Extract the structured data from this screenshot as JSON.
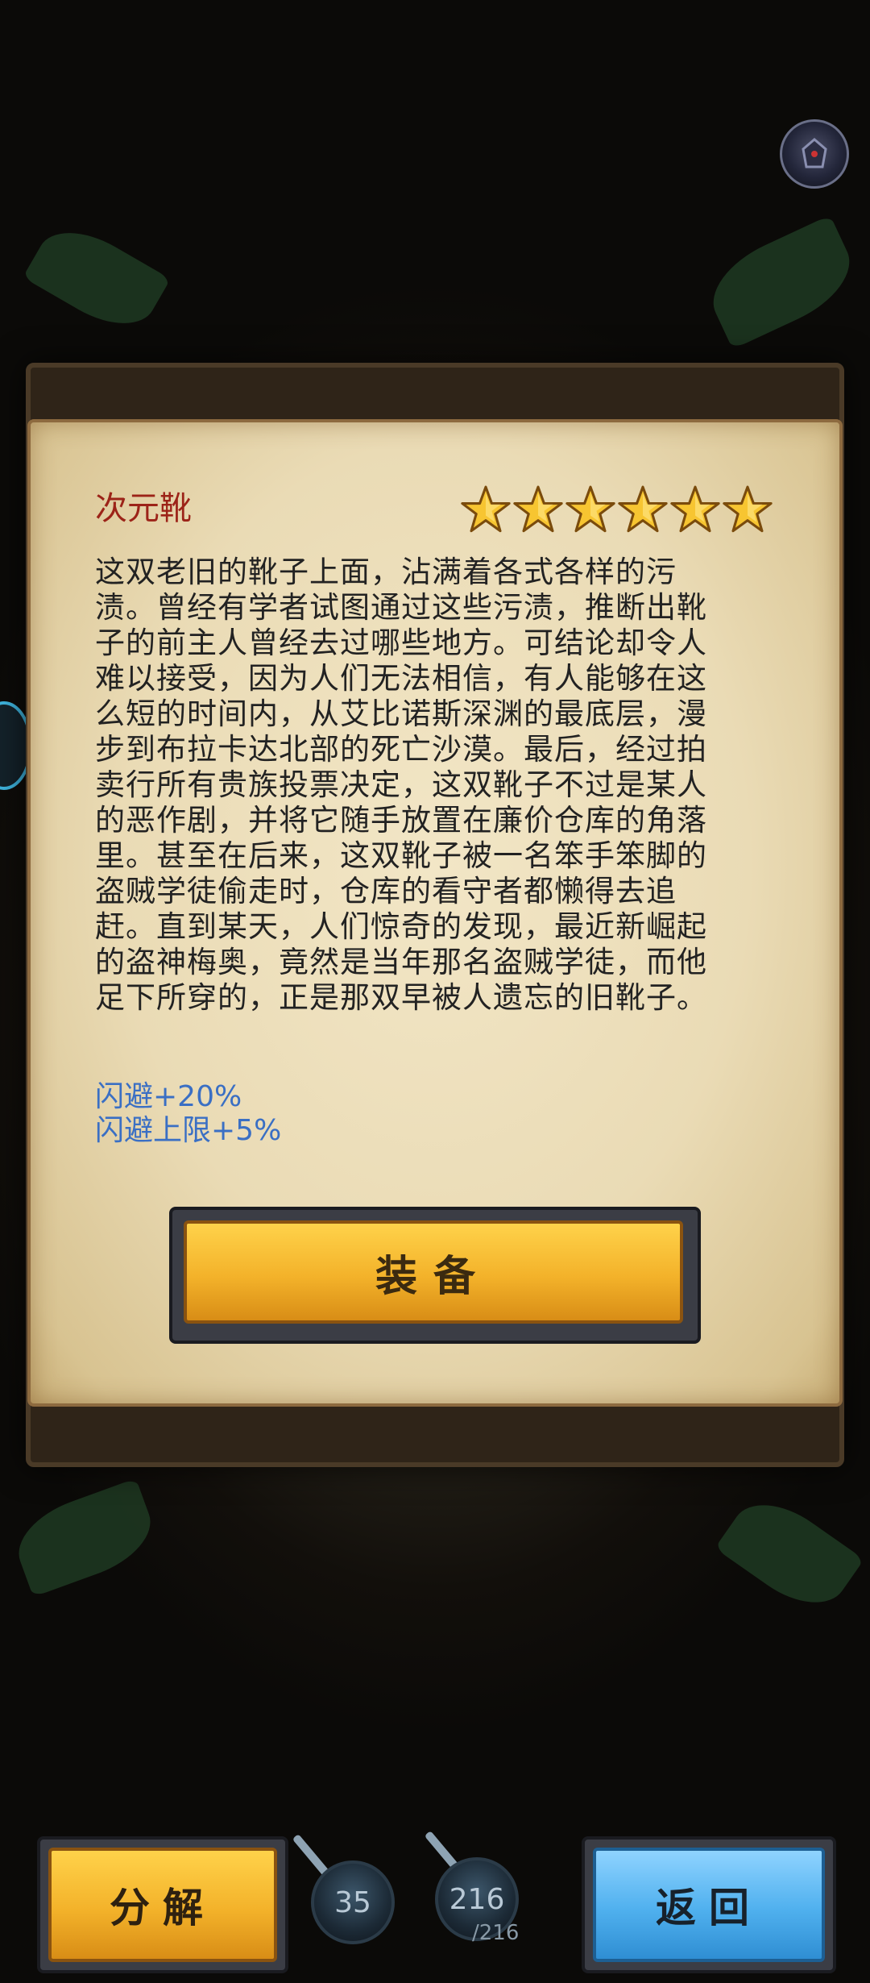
{
  "item": {
    "name": "次元靴",
    "stars": 6,
    "description": "这双老旧的靴子上面，沾满着各式各样的污渍。曾经有学者试图通过这些污渍，推断出靴子的前主人曾经去过哪些地方。可结论却令人难以接受，因为人们无法相信，有人能够在这么短的时间内，从艾比诺斯深渊的最底层，漫步到布拉卡达北部的死亡沙漠。最后，经过拍卖行所有贵族投票决定，这双靴子不过是某人的恶作剧，并将它随手放置在廉价仓库的角落里。甚至在后来，这双靴子被一名笨手笨脚的盗贼学徒偷走时，仓库的看守者都懒得去追赶。直到某天，人们惊奇的发现，最近新崛起的盗神梅奥，竟然是当年那名盗贼学徒，而他足下所穿的，正是那双早被人遗忘的旧靴子。",
    "stats": [
      "闪避+20%",
      "闪避上限+5%"
    ]
  },
  "buttons": {
    "equip": "装备",
    "decompose": "分解",
    "return": "返回"
  },
  "counters": {
    "left_value": "35",
    "right_value": "216",
    "right_max": "/216"
  },
  "colors": {
    "name_red": "#9c2318",
    "stat_blue": "#3a6fc4",
    "gold_button": "#f3b22a",
    "blue_button": "#4fb0ee",
    "parchment": "#eadbb5"
  }
}
